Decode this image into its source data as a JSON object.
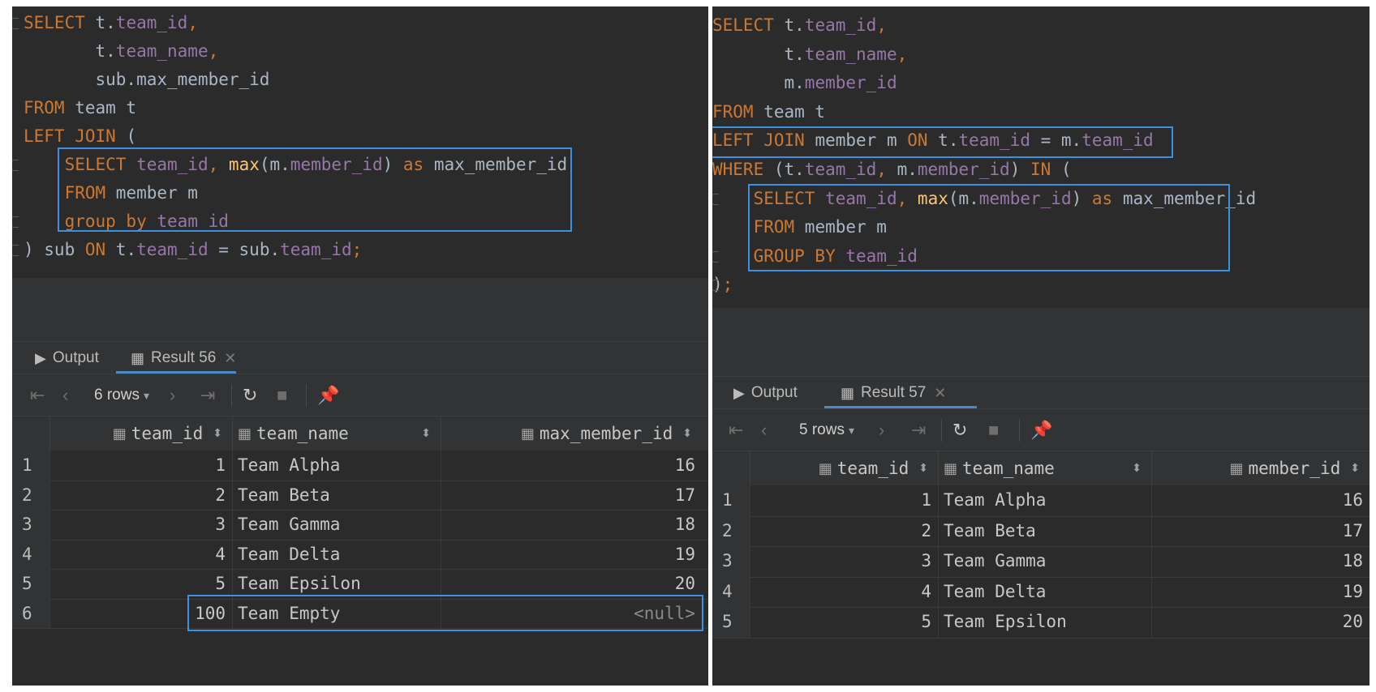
{
  "left": {
    "code": [
      [
        [
          "k",
          "SELECT"
        ],
        [
          "p",
          " t."
        ],
        [
          "u",
          "team_id"
        ],
        [
          "k",
          ","
        ]
      ],
      [
        [
          "p",
          "       t."
        ],
        [
          "u",
          "team_name"
        ],
        [
          "k",
          ","
        ]
      ],
      [
        [
          "p",
          "       sub.max_member_id"
        ]
      ],
      [
        [
          "k",
          "FROM"
        ],
        [
          "p",
          " team t"
        ]
      ],
      [
        [
          "k",
          "LEFT JOIN"
        ],
        [
          "p",
          " ("
        ]
      ],
      [
        [
          "p",
          "    "
        ],
        [
          "k",
          "SELECT"
        ],
        [
          "p",
          " "
        ],
        [
          "u",
          "team_id"
        ],
        [
          "k",
          ","
        ],
        [
          "p",
          " "
        ],
        [
          "f",
          "max"
        ],
        [
          "p",
          "(m."
        ],
        [
          "u",
          "member_id"
        ],
        [
          "p",
          ") "
        ],
        [
          "k",
          "as"
        ],
        [
          "p",
          " max_member_id"
        ]
      ],
      [
        [
          "p",
          "    "
        ],
        [
          "k",
          "FROM"
        ],
        [
          "p",
          " member m"
        ]
      ],
      [
        [
          "p",
          "    "
        ],
        [
          "k",
          "group by"
        ],
        [
          "p",
          " "
        ],
        [
          "u",
          "team_id"
        ]
      ],
      [
        [
          "p",
          ") sub "
        ],
        [
          "k",
          "ON"
        ],
        [
          "p",
          " t."
        ],
        [
          "u",
          "team_id"
        ],
        [
          "p",
          " = sub."
        ],
        [
          "u",
          "team_id"
        ],
        [
          "k",
          ";"
        ]
      ]
    ],
    "tabs": {
      "output": "Output",
      "result": "Result 56"
    },
    "rows_label": "6 rows",
    "columns": [
      "team_id",
      "team_name",
      "max_member_id"
    ],
    "rows": [
      {
        "n": "1",
        "id": "1",
        "name": "Team Alpha",
        "val": "16"
      },
      {
        "n": "2",
        "id": "2",
        "name": "Team Beta",
        "val": "17"
      },
      {
        "n": "3",
        "id": "3",
        "name": "Team Gamma",
        "val": "18"
      },
      {
        "n": "4",
        "id": "4",
        "name": "Team Delta",
        "val": "19"
      },
      {
        "n": "5",
        "id": "5",
        "name": "Team Epsilon",
        "val": "20"
      },
      {
        "n": "6",
        "id": "100",
        "name": "Team Empty",
        "val": "<null>"
      }
    ]
  },
  "right": {
    "code": [
      [
        [
          "k",
          "SELECT"
        ],
        [
          "p",
          " t."
        ],
        [
          "u",
          "team_id"
        ],
        [
          "k",
          ","
        ]
      ],
      [
        [
          "p",
          "       t."
        ],
        [
          "u",
          "team_name"
        ],
        [
          "k",
          ","
        ]
      ],
      [
        [
          "p",
          "       m."
        ],
        [
          "u",
          "member_id"
        ]
      ],
      [
        [
          "k",
          "FROM"
        ],
        [
          "p",
          " team t"
        ]
      ],
      [
        [
          "k",
          "LEFT JOIN"
        ],
        [
          "p",
          " member m "
        ],
        [
          "k",
          "ON"
        ],
        [
          "p",
          " t."
        ],
        [
          "u",
          "team_id"
        ],
        [
          "p",
          " = m."
        ],
        [
          "u",
          "team_id"
        ]
      ],
      [
        [
          "k",
          "WHERE"
        ],
        [
          "p",
          " (t."
        ],
        [
          "u",
          "team_id"
        ],
        [
          "k",
          ","
        ],
        [
          "p",
          " m."
        ],
        [
          "u",
          "member_id"
        ],
        [
          "p",
          ") "
        ],
        [
          "k",
          "IN"
        ],
        [
          "p",
          " ("
        ]
      ],
      [
        [
          "p",
          "    "
        ],
        [
          "k",
          "SELECT"
        ],
        [
          "p",
          " "
        ],
        [
          "u",
          "team_id"
        ],
        [
          "k",
          ","
        ],
        [
          "p",
          " "
        ],
        [
          "f",
          "max"
        ],
        [
          "p",
          "(m."
        ],
        [
          "u",
          "member_id"
        ],
        [
          "p",
          ") "
        ],
        [
          "k",
          "as"
        ],
        [
          "p",
          " max_member_id"
        ]
      ],
      [
        [
          "p",
          "    "
        ],
        [
          "k",
          "FROM"
        ],
        [
          "p",
          " member m"
        ]
      ],
      [
        [
          "p",
          "    "
        ],
        [
          "k",
          "GROUP BY"
        ],
        [
          "p",
          " "
        ],
        [
          "u",
          "team_id"
        ]
      ],
      [
        [
          "p",
          ")"
        ],
        [
          "k",
          ";"
        ]
      ]
    ],
    "tabs": {
      "output": "Output",
      "result": "Result 57"
    },
    "rows_label": "5 rows",
    "columns": [
      "team_id",
      "team_name",
      "member_id"
    ],
    "rows": [
      {
        "n": "1",
        "id": "1",
        "name": "Team Alpha",
        "val": "16"
      },
      {
        "n": "2",
        "id": "2",
        "name": "Team Beta",
        "val": "17"
      },
      {
        "n": "3",
        "id": "3",
        "name": "Team Gamma",
        "val": "18"
      },
      {
        "n": "4",
        "id": "4",
        "name": "Team Delta",
        "val": "19"
      },
      {
        "n": "5",
        "id": "5",
        "name": "Team Epsilon",
        "val": "20"
      }
    ]
  },
  "icons": {
    "output": "output-console-icon",
    "result": "table-icon",
    "first": "first-page-icon",
    "prev": "previous-page-icon",
    "next": "next-page-icon",
    "last": "last-page-icon",
    "refresh": "refresh-icon",
    "stop": "stop-icon",
    "pin": "pin-icon",
    "column": "column-table-icon",
    "sort": "sort-icon"
  },
  "colors": {
    "keyword": "#cc7832",
    "function": "#ffc66d",
    "identifier": "#9876aa",
    "plain": "#a9b7c6",
    "highlight": "#3d8fe0",
    "background": "#2b2b2b"
  }
}
